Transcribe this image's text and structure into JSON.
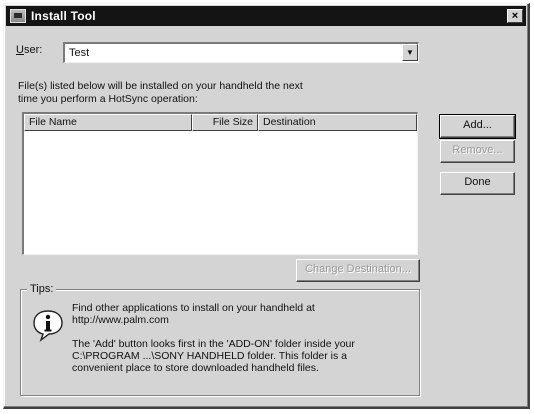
{
  "window": {
    "title": "Install Tool",
    "close_symbol": "×"
  },
  "user": {
    "label_prefix": "",
    "label_hotkey": "U",
    "label_rest": "ser:",
    "selected": "Test",
    "dropdown_arrow": "▼"
  },
  "info": {
    "line1": "File(s) listed below will be installed on your handheld the next",
    "line2": "time you perform a HotSync operation:"
  },
  "list": {
    "columns": [
      "File Name",
      "File Size",
      "Destination"
    ],
    "rows": []
  },
  "buttons": {
    "add": "Add...",
    "remove": "Remove...",
    "done": "Done",
    "change_destination": "Change Destination..."
  },
  "tips": {
    "legend": "Tips:",
    "icon": "info-bubble-icon",
    "para1_line1": "Find other applications to install on your handheld at",
    "para1_line2": "http://www.palm.com",
    "para2_line1": "The 'Add' button looks first in the 'ADD-ON' folder inside your",
    "para2_line2": "C:\\PROGRAM ...\\SONY HANDHELD folder. This folder is a",
    "para2_line3": "convenient place to store downloaded handheld files."
  }
}
